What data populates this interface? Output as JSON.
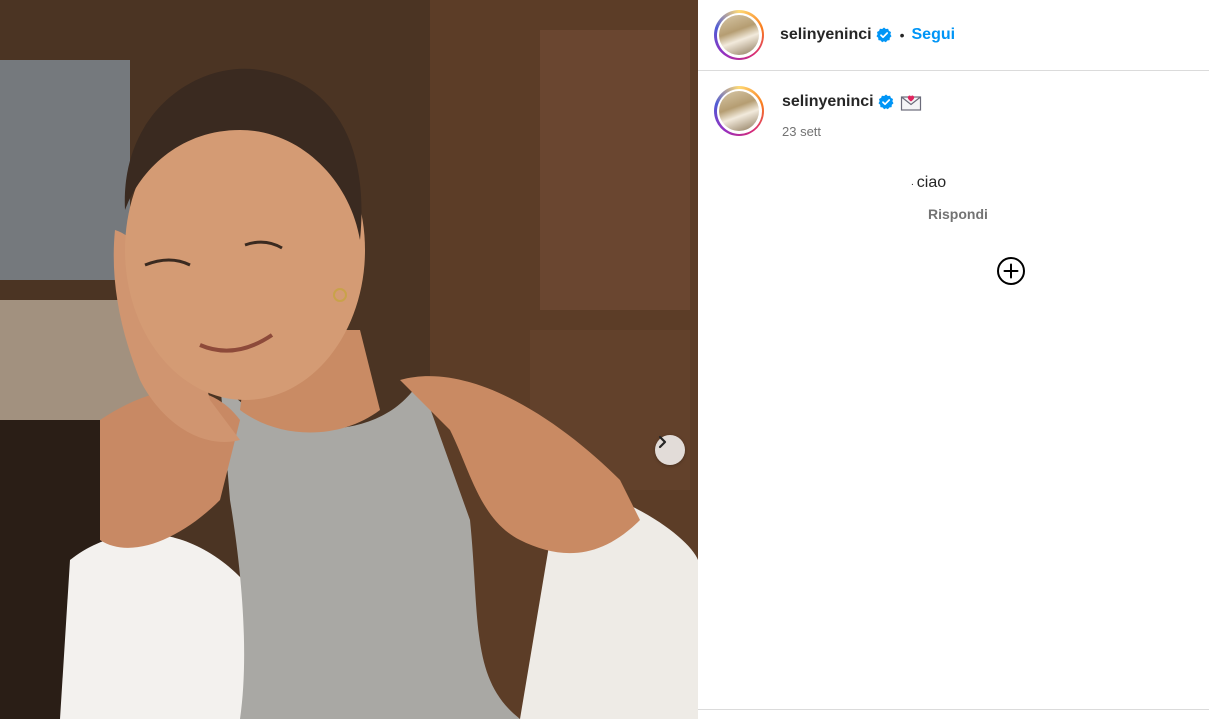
{
  "post": {
    "username": "selinyeninci",
    "follow_label": "Segui",
    "separator": "•"
  },
  "comment": {
    "username": "selinyeninci",
    "date": "23 sett",
    "caption_text": "ciao",
    "caption_mark": ".",
    "reply_label": "Rispondi"
  },
  "icons": {
    "verified": "verified-badge-icon",
    "envelope": "love-letter-emoji-icon",
    "next": "chevron-right-icon",
    "load_more": "plus-circle-icon"
  },
  "colors": {
    "accent": "#0095f6",
    "text": "#262626",
    "secondary": "#737373",
    "border": "#dbdbdb"
  }
}
